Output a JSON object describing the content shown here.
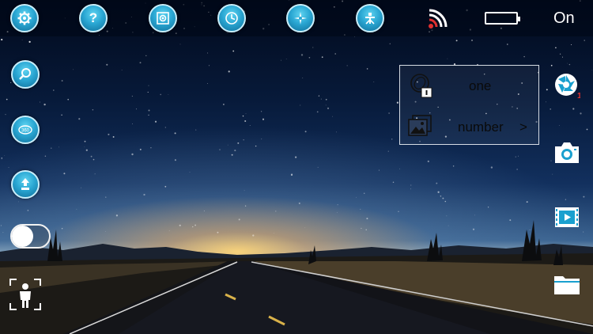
{
  "topbar": {
    "settings_icon": "gear-icon",
    "help_label": "?",
    "capture_mode_icon": "camera-frame-icon",
    "timer_icon": "clock-icon",
    "exposure_icon": "compass-star-icon",
    "gimbal_icon": "tripod-icon",
    "signal_icon": "wireless-signal-icon",
    "battery_icon": "battery-icon",
    "status_label": "On"
  },
  "left_controls": {
    "focus_icon": "magnifier-icon",
    "panorama_icon": "360-rotate-icon",
    "lift_icon": "up-arrow-icon",
    "toggle_on": false,
    "tracking_icon": "person-frame-icon"
  },
  "mode_panel": {
    "mode_label": "one",
    "count_label": "number",
    "count_arrow": ">"
  },
  "right_controls": {
    "aperture_icon": "aperture-icon",
    "aperture_badge": "1",
    "camera_icon": "camera-icon",
    "video_icon": "video-play-icon",
    "folder_icon": "folder-icon"
  },
  "colors": {
    "button_blue": "#2aa7d3",
    "button_border": "#c9eefa",
    "signal_red": "#e03030"
  }
}
